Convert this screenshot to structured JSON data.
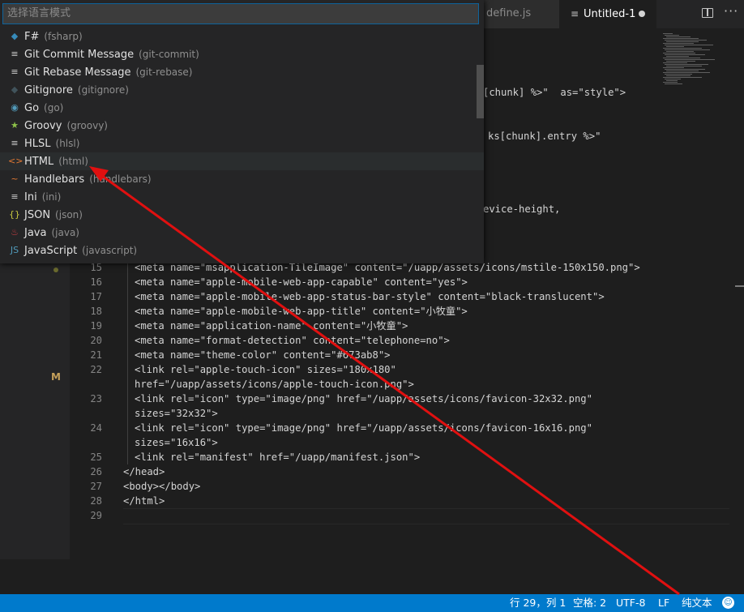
{
  "tabs": [
    {
      "label": "define.js"
    },
    {
      "label": "Untitled-1",
      "file_icon": "≡"
    }
  ],
  "quick_pick": {
    "placeholder": "选择语言模式",
    "items": [
      {
        "icon": "fsharp-icon",
        "glyph": "◆",
        "color": "#378bba",
        "label": "F#",
        "desc": "(fsharp)"
      },
      {
        "icon": "lines-icon",
        "glyph": "≡",
        "color": "#cccccc",
        "label": "Git Commit Message",
        "desc": "(git-commit)"
      },
      {
        "icon": "lines-icon",
        "glyph": "≡",
        "color": "#cccccc",
        "label": "Git Rebase Message",
        "desc": "(git-rebase)"
      },
      {
        "icon": "diamond-icon",
        "glyph": "◆",
        "color": "#41535b",
        "label": "Gitignore",
        "desc": "(gitignore)"
      },
      {
        "icon": "go-gopher-icon",
        "glyph": "◉",
        "color": "#519aba",
        "label": "Go",
        "desc": "(go)"
      },
      {
        "icon": "groovy-star-icon",
        "glyph": "★",
        "color": "#8dc149",
        "label": "Groovy",
        "desc": "(groovy)"
      },
      {
        "icon": "lines-icon",
        "glyph": "≡",
        "color": "#cccccc",
        "label": "HLSL",
        "desc": "(hlsl)"
      },
      {
        "icon": "html-brackets-icon",
        "glyph": "<>",
        "color": "#e37933",
        "label": "HTML",
        "desc": "(html)"
      },
      {
        "icon": "handlebars-icon",
        "glyph": "~",
        "color": "#e37933",
        "label": "Handlebars",
        "desc": "(handlebars)"
      },
      {
        "icon": "lines-icon",
        "glyph": "≡",
        "color": "#cccccc",
        "label": "Ini",
        "desc": "(ini)"
      },
      {
        "icon": "json-braces-icon",
        "glyph": "{}",
        "color": "#cbcb41",
        "label": "JSON",
        "desc": "(json)"
      },
      {
        "icon": "java-cup-icon",
        "glyph": "♨",
        "color": "#cc3e44",
        "label": "Java",
        "desc": "(java)"
      },
      {
        "icon": "js-icon",
        "glyph": "JS",
        "color": "#519aba",
        "label": "JavaScript",
        "desc": "(javascript)"
      }
    ]
  },
  "editor": {
    "partial_lines": [
      "[chunk] %>\"  as=\"style\">",
      "ks[chunk].entry %>\"",
      "evice-height,"
    ],
    "lines": [
      {
        "n": "15",
        "text": "<meta name=\"msapplication-TileImage\" content=\"/uapp/assets/icons/mstile-150x150.png\">"
      },
      {
        "n": "16",
        "text": "<meta name=\"apple-mobile-web-app-capable\" content=\"yes\">"
      },
      {
        "n": "17",
        "text": "<meta name=\"apple-mobile-web-app-status-bar-style\" content=\"black-translucent\">"
      },
      {
        "n": "18",
        "text": "<meta name=\"apple-mobile-web-app-title\" content=\"小牧童\">"
      },
      {
        "n": "19",
        "text": "<meta name=\"application-name\" content=\"小牧童\">"
      },
      {
        "n": "20",
        "text": "<meta name=\"format-detection\" content=\"telephone=no\">"
      },
      {
        "n": "21",
        "text": "<meta name=\"theme-color\" content=\"#673ab8\">"
      },
      {
        "n": "22",
        "text": "<link rel=\"apple-touch-icon\" sizes=\"180x180\""
      },
      {
        "n": "",
        "text": "href=\"/uapp/assets/icons/apple-touch-icon.png\">"
      },
      {
        "n": "23",
        "text": "<link rel=\"icon\" type=\"image/png\" href=\"/uapp/assets/icons/favicon-32x32.png\""
      },
      {
        "n": "",
        "text": "sizes=\"32x32\">"
      },
      {
        "n": "24",
        "text": "<link rel=\"icon\" type=\"image/png\" href=\"/uapp/assets/icons/favicon-16x16.png\""
      },
      {
        "n": "",
        "text": "sizes=\"16x16\">"
      },
      {
        "n": "25",
        "text": "<link rel=\"manifest\" href=\"/uapp/manifest.json\">"
      },
      {
        "n": "26",
        "text": "</head>"
      },
      {
        "n": "27",
        "text": "<body></body>"
      },
      {
        "n": "28",
        "text": "</html>"
      },
      {
        "n": "29",
        "text": ""
      }
    ],
    "git_marker": "M"
  },
  "status_bar": {
    "position": "行 29，列 1",
    "indent": "空格: 2",
    "encoding": "UTF-8",
    "eol": "LF",
    "language": "纯文本"
  },
  "colors": {
    "status_bar": "#007acc",
    "annotation_arrow": "#e01010"
  }
}
